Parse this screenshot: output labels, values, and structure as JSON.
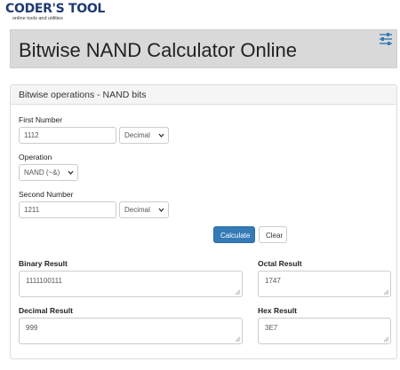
{
  "brand": {
    "title": "CODER'S TOOL",
    "subtitle": "online tools and utilities"
  },
  "page": {
    "title": "Bitwise NAND Calculator Online"
  },
  "icons": {
    "menu": "sliders-icon",
    "dropdown": "chevron-down-icon"
  },
  "panel": {
    "heading": "Bitwise operations - NAND bits"
  },
  "form": {
    "first_label": "First Number",
    "first_value": "1112",
    "first_base": "Decimal",
    "operation_label": "Operation",
    "operation_value": "NAND (~&)",
    "second_label": "Second Number",
    "second_value": "1211",
    "second_base": "Decimal",
    "calculate_label": "Calculate",
    "clear_label": "Clear"
  },
  "results": {
    "binary_label": "Binary Result",
    "binary_value": "1111100111",
    "octal_label": "Octal Result",
    "octal_value": "1747",
    "decimal_label": "Decimal Result",
    "decimal_value": "999",
    "hex_label": "Hex Result",
    "hex_value": "3E7"
  },
  "colors": {
    "primary": "#337ab7",
    "header_bg": "#d9d9d9",
    "brand": "#1f3b73"
  }
}
